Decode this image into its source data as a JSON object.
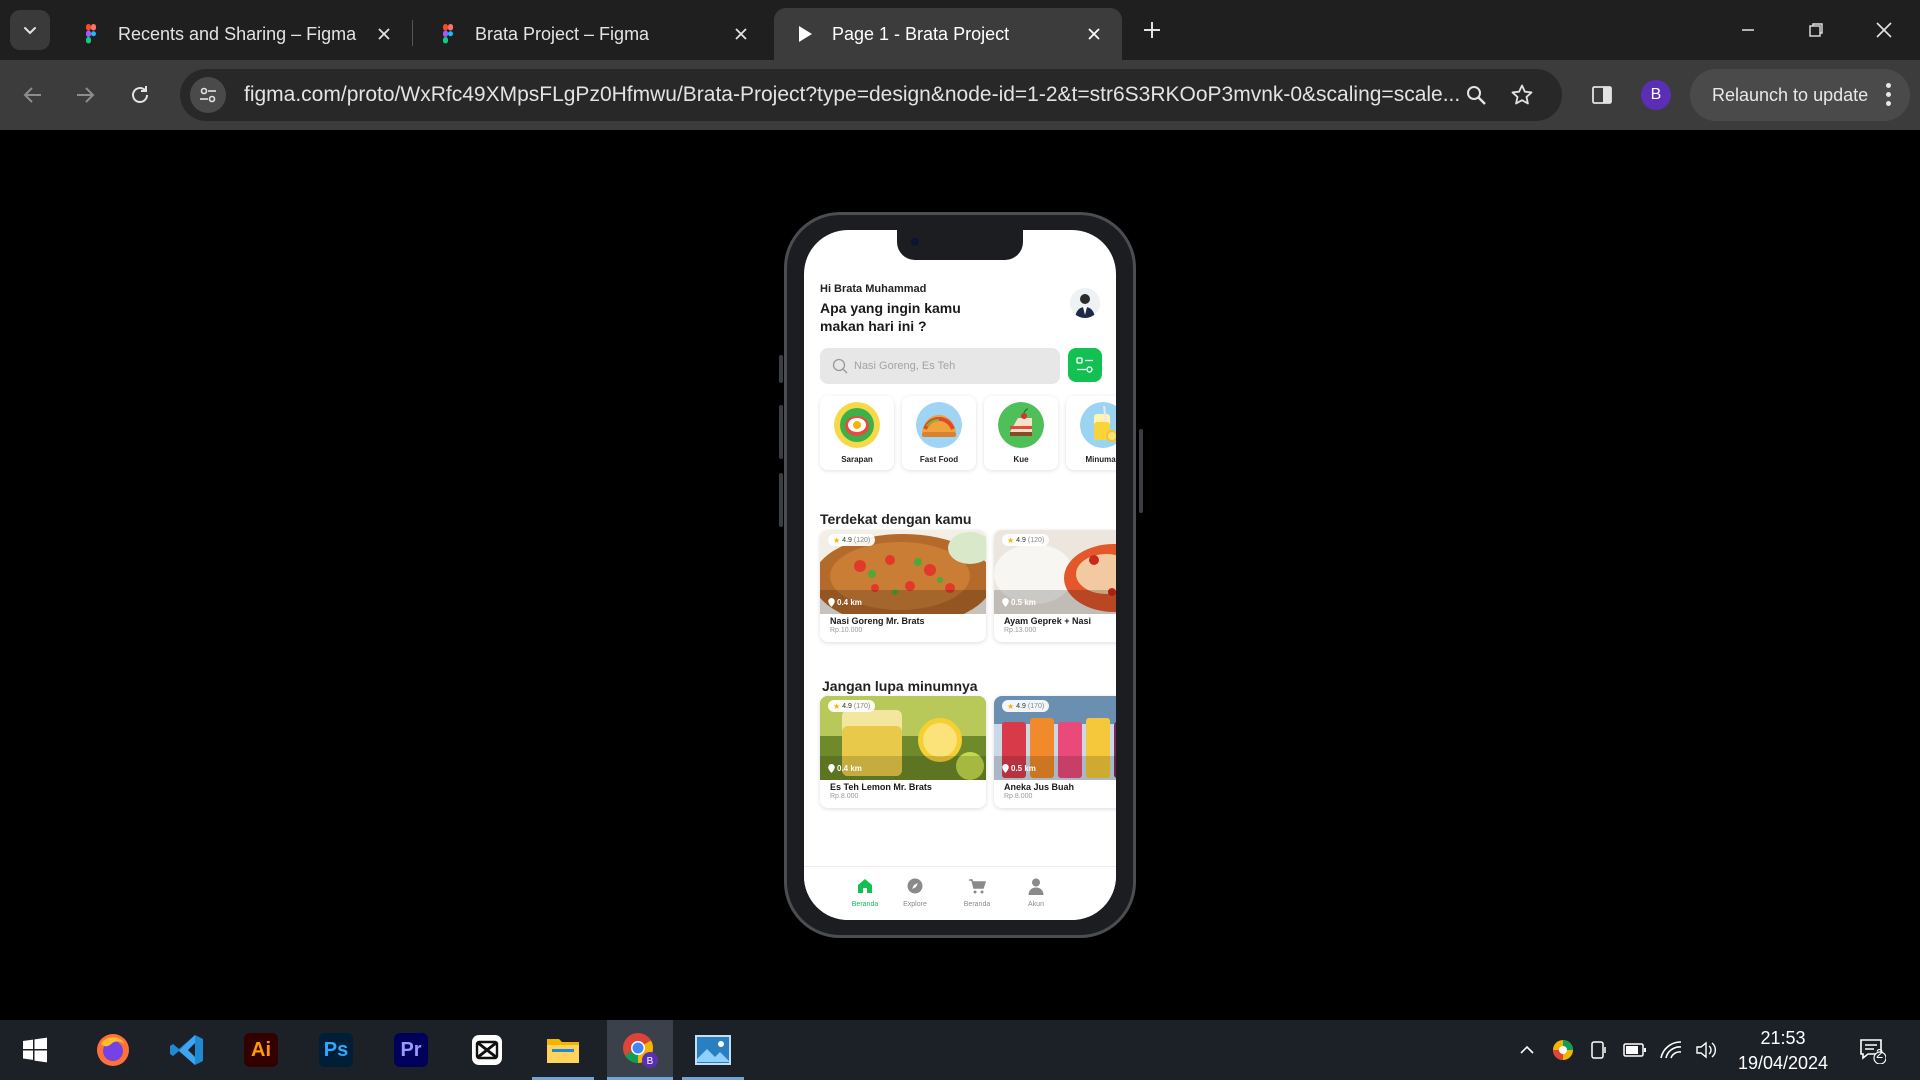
{
  "browser": {
    "tabs": [
      {
        "title": "Recents and Sharing – Figma",
        "icon": "figma-icon"
      },
      {
        "title": "Brata Project – Figma",
        "icon": "figma-icon"
      },
      {
        "title": "Page 1 - Brata Project",
        "icon": "play-icon",
        "active": true
      }
    ],
    "url": "figma.com/proto/WxRfc49XMpsFLgPz0Hfmwu/Brata-Project?type=design&node-id=1-2&t=str6S3RKOoP3mvnk-0&scaling=scale...",
    "profile_initial": "B",
    "relaunch_label": "Relaunch to update"
  },
  "app": {
    "greeting": "Hi Brata Muhammad",
    "question": "Apa yang ingin kamu makan hari ini ?",
    "search_placeholder": "Nasi Goreng, Es Teh",
    "categories": [
      {
        "label": "Sarapan",
        "icon": "breakfast-icon"
      },
      {
        "label": "Fast Food",
        "icon": "taco-icon"
      },
      {
        "label": "Kue",
        "icon": "cake-icon"
      },
      {
        "label": "Minuman",
        "icon": "drink-icon"
      }
    ],
    "nearby": {
      "title": "Terdekat dengan kamu",
      "items": [
        {
          "name": "Nasi Goreng Mr. Brats",
          "price": "Rp.10.000",
          "rating": "4.9",
          "reviews": "(120)",
          "distance": "0.4 km"
        },
        {
          "name": "Ayam Geprek + Nasi",
          "price": "Rp.13.000",
          "rating": "4.9",
          "reviews": "(120)",
          "distance": "0.5 km"
        }
      ]
    },
    "drinks": {
      "title": "Jangan lupa minumnya",
      "items": [
        {
          "name": "Es Teh Lemon Mr. Brats",
          "price": "Rp.8.000",
          "rating": "4.9",
          "reviews": "(170)",
          "distance": "0.4 km"
        },
        {
          "name": "Aneka Jus Buah",
          "price": "Rp.8.000",
          "rating": "4.9",
          "reviews": "(170)",
          "distance": "0.5 km"
        }
      ]
    },
    "bottom_nav": [
      {
        "label": "Beranda",
        "icon": "home-icon",
        "active": true
      },
      {
        "label": "Explore",
        "icon": "compass-icon"
      },
      {
        "label": "Beranda",
        "icon": "cart-icon"
      },
      {
        "label": "Akun",
        "icon": "user-icon"
      }
    ],
    "accent_color": "#12c152"
  },
  "taskbar": {
    "apps": [
      "windows-start-icon",
      "firefox-icon",
      "vscode-icon",
      "illustrator-icon",
      "photoshop-icon",
      "premiere-icon",
      "capcut-icon",
      "file-explorer-icon",
      "chrome-icon",
      "photos-icon"
    ],
    "app_labels": {
      "illustrator": "Ai",
      "photoshop": "Ps",
      "premiere": "Pr"
    },
    "time": "21:53",
    "date": "19/04/2024",
    "notification_count": "2"
  }
}
